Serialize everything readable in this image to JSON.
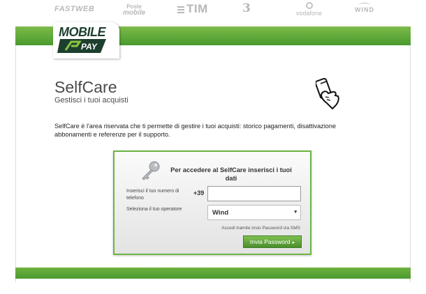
{
  "operators": {
    "fastweb": "FASTWEB",
    "poste_top": "Poste",
    "poste_bottom": "mobile",
    "tim": "TIM",
    "three": "3",
    "vodafone": "vodafone",
    "wind": "WIND"
  },
  "logo": {
    "line1": "MOBILE",
    "line2": "PAY"
  },
  "header": {
    "title": "SelfCare",
    "subtitle": "Gestisci i tuoi acquisti"
  },
  "description": "SelfCare è l'area riservata che ti permette di gestire i tuoi acquisti: storico pagamenti, disattivazione abbonamenti e referenze per il supporto.",
  "form": {
    "title": "Per accedere al SelfCare inserisci i tuoi dati",
    "phone_label": "Inserisci il tuo numero di telefono",
    "phone_prefix": "+39",
    "phone_value": "",
    "operator_label": "Seleziona il tuo operatore",
    "operator_selected": "Wind",
    "sms_link": "Accedi tramite invio Password via SMS",
    "submit_label": "Invia Password",
    "submit_arrow": "▸"
  },
  "colors": {
    "accent_green": "#6cb544",
    "dark_green": "#4a9a2f"
  },
  "icons": {
    "key": "key-icon",
    "hand": "hand-phone-icon",
    "caret": "chevron-down-icon"
  }
}
